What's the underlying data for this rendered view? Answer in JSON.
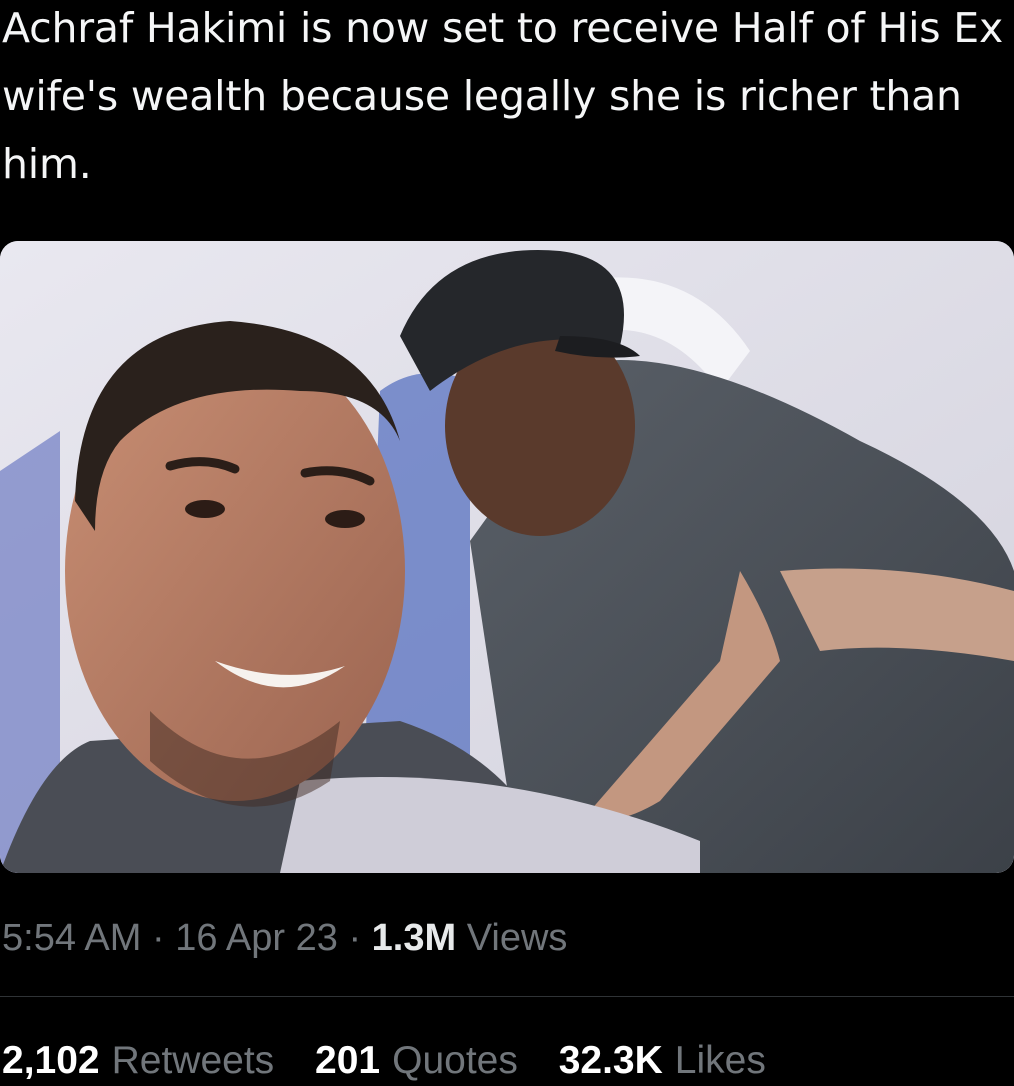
{
  "tweet": {
    "text": "Achraf Hakimi is now set to receive Half of His Ex wife's wealth because legally she is richer than him.",
    "media_alt_icon": "photo-icon",
    "time": "5:54 AM",
    "separator": "·",
    "date": "16 Apr 23",
    "views_count": "1.3M",
    "views_label": "Views"
  },
  "stats": {
    "retweets_count": "2,102",
    "retweets_label": "Retweets",
    "quotes_count": "201",
    "quotes_label": "Quotes",
    "likes_count": "32.3K",
    "likes_label": "Likes"
  },
  "colors": {
    "background": "#000000",
    "text": "#e7e9ea",
    "muted": "#71767b",
    "divider": "#2f3336"
  }
}
